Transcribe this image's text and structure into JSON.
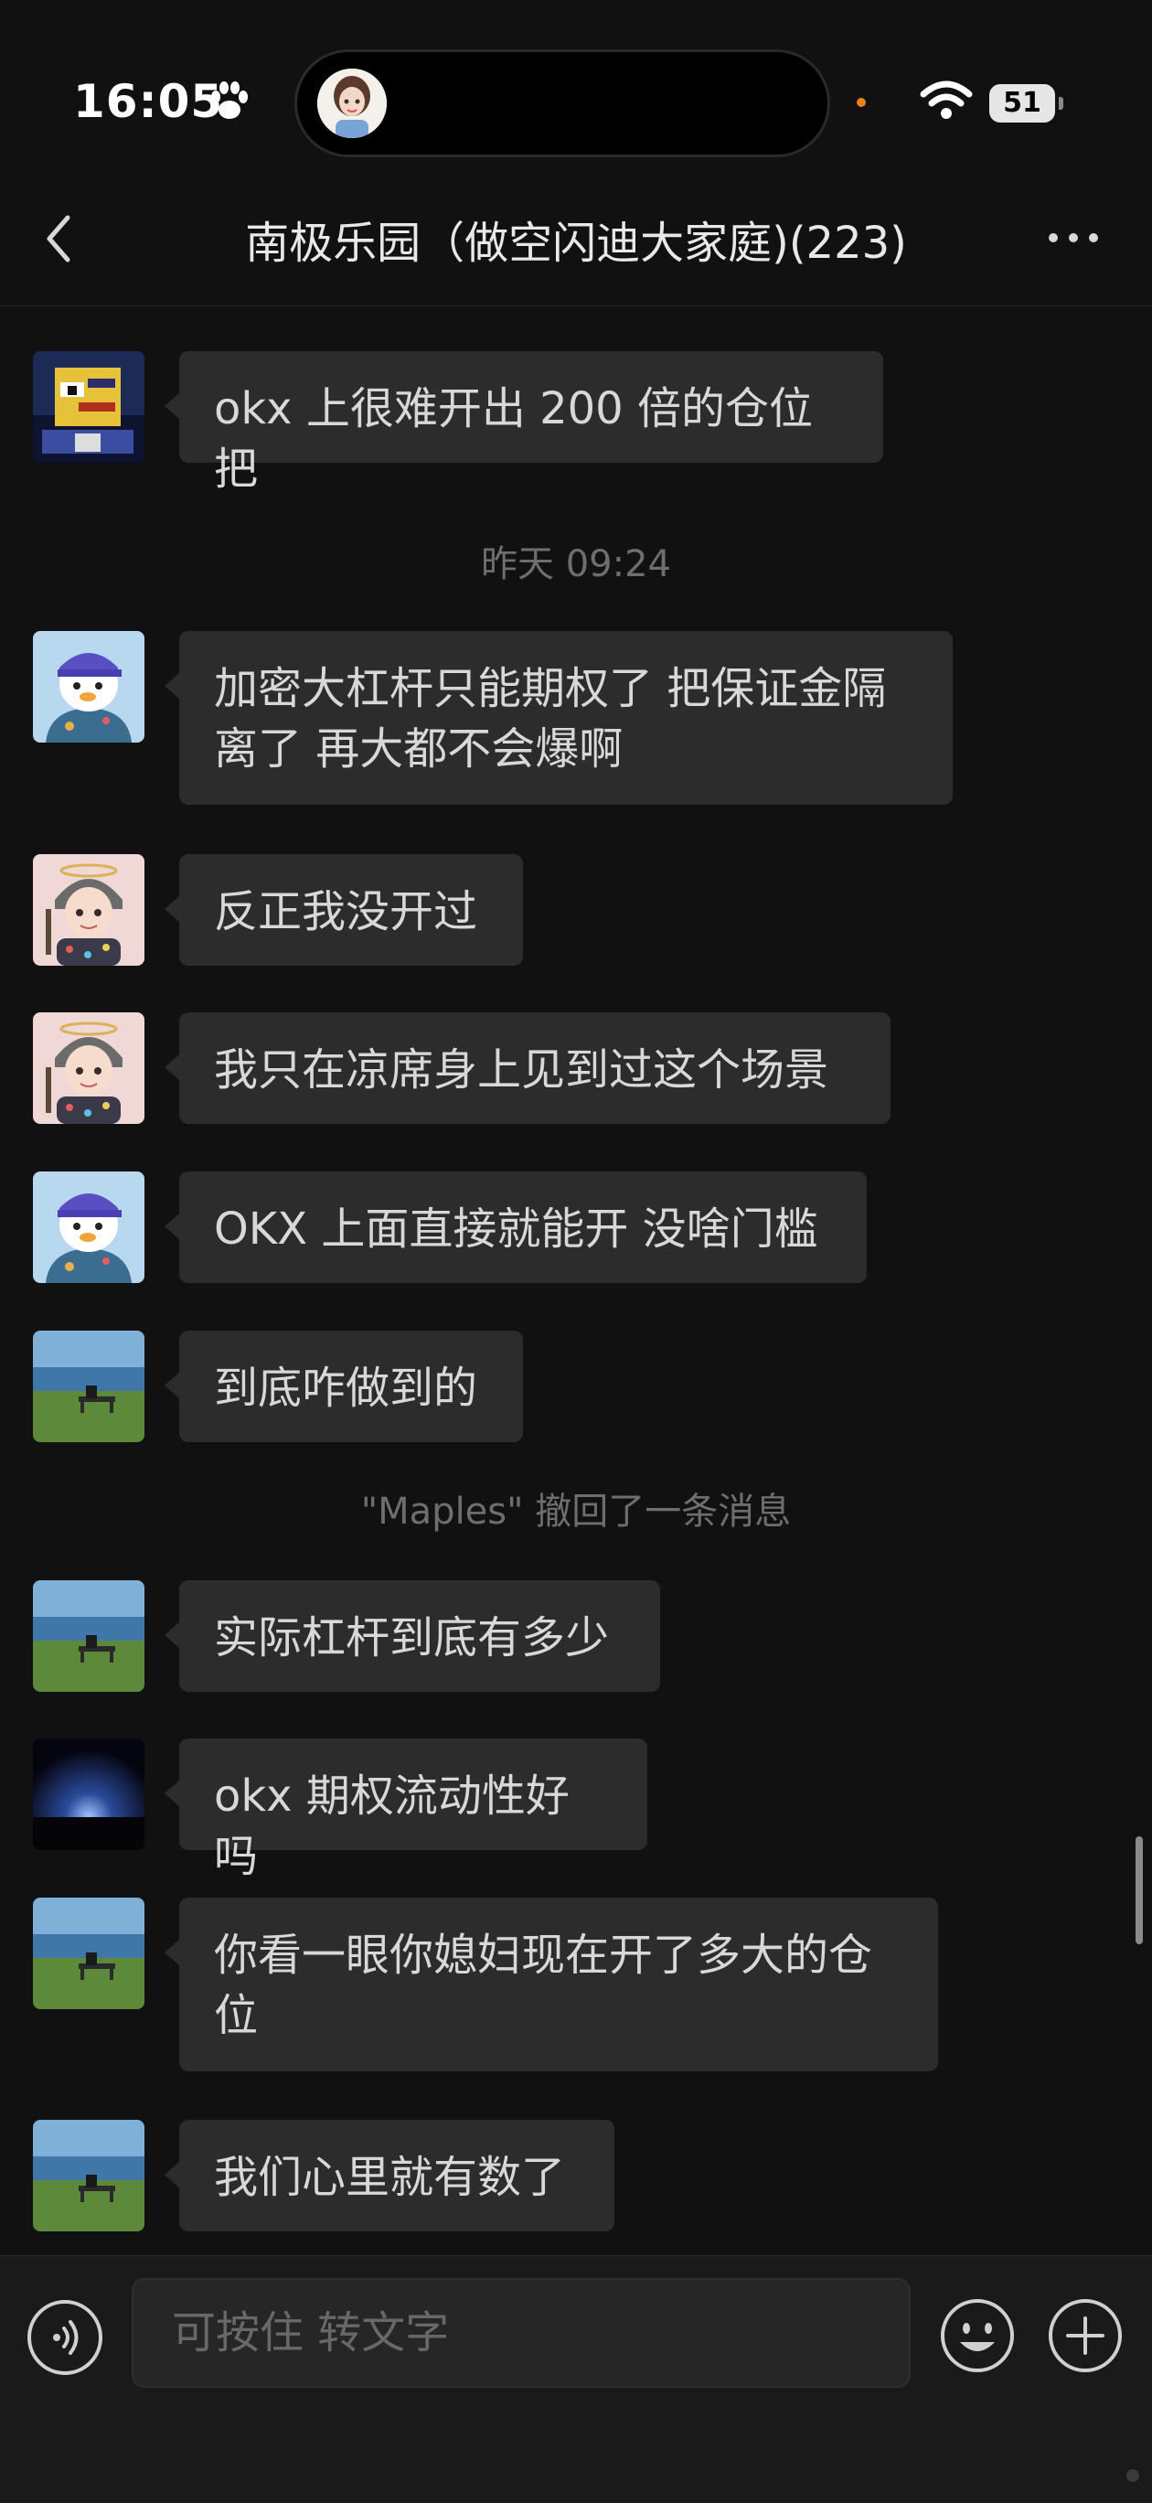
{
  "status_bar": {
    "time": "16:05",
    "battery": "51"
  },
  "nav": {
    "title": "南极乐园（做空闪迪大家庭)(223)"
  },
  "messages": [
    {
      "text": "okx 上很难开出 200 倍的仓位把",
      "avatar": "pixel-art-avatar"
    },
    {
      "text": "加密大杠杆只能期权了 把保证金隔离了 再大都不会爆啊",
      "avatar": "penguin-avatar"
    },
    {
      "text": "反正我没开过",
      "avatar": "anime-girl-avatar"
    },
    {
      "text": "我只在凉席身上见到过这个场景",
      "avatar": "anime-girl-avatar"
    },
    {
      "text": "OKX 上面直接就能开 没啥门槛",
      "avatar": "penguin-avatar"
    },
    {
      "text": "到底咋做到的",
      "avatar": "seaside-bench-avatar"
    },
    {
      "text": "实际杠杆到底有多少",
      "avatar": "seaside-bench-avatar"
    },
    {
      "text": "okx 期权流动性好吗",
      "avatar": "dark-sky-avatar"
    },
    {
      "text": "你看一眼你媳妇现在开了多大的仓位",
      "avatar": "seaside-bench-avatar"
    },
    {
      "text": "我们心里就有数了",
      "avatar": "seaside-bench-avatar"
    }
  ],
  "system": {
    "timestamp": "昨天 09:24",
    "recall_notice": "\"Maples\" 撤回了一条消息"
  },
  "input_bar": {
    "placeholder": "可按住 转文字"
  },
  "colors": {
    "background": "#111111",
    "bubble": "#2c2c2c",
    "accent": "#e8801f"
  }
}
